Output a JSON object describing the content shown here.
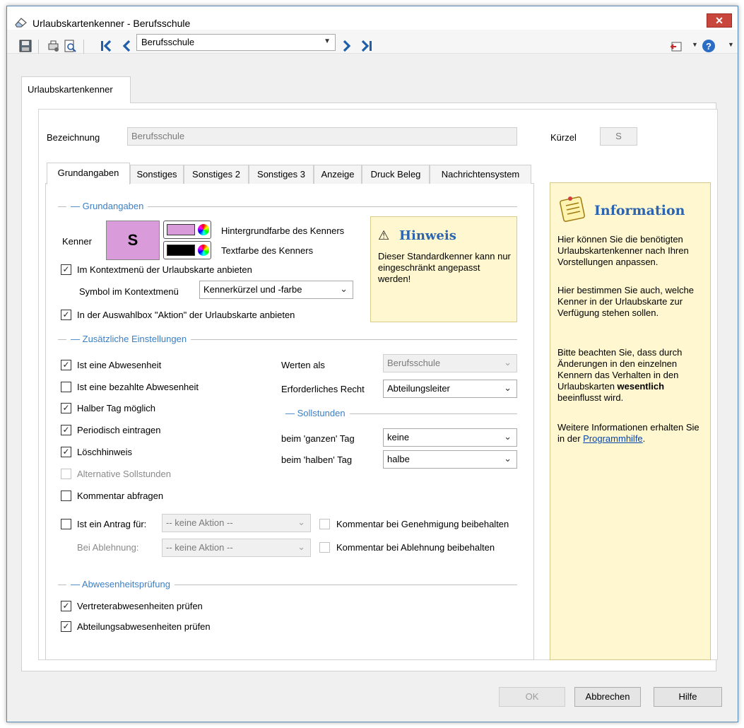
{
  "window": {
    "title": "Urlaubskartenkenner - Berufsschule",
    "close_glyph": "✕"
  },
  "toolbar": {
    "record_value": "Berufsschule",
    "icons": [
      "save-icon",
      "print-setup-icon",
      "print-preview-icon",
      "first-record-icon",
      "previous-record-icon",
      "next-record-icon",
      "last-record-icon",
      "exit-icon",
      "help-icon"
    ]
  },
  "outer_tab": {
    "label": "Urlaubskartenkenner"
  },
  "header": {
    "bezeichnung_label": "Bezeichnung",
    "bezeichnung_value": "Berufsschule",
    "kuerzel_label": "Kürzel",
    "kuerzel_value": "S"
  },
  "tabs": [
    "Grundangaben",
    "Sonstiges",
    "Sonstiges 2",
    "Sonstiges 3",
    "Anzeige",
    "Druck Beleg",
    "Nachrichtensystem"
  ],
  "grundangaben": {
    "section_title": "Grundangaben",
    "kenner_label": "Kenner",
    "kenner_symbol": "S",
    "kenner_bg_color": "#d99bd9",
    "kenner_text_color": "#000000",
    "bg_color_label": "Hintergrundfarbe des Kenners",
    "text_color_label": "Textfarbe des Kenners",
    "context_menu_label": "Im Kontextmenü der Urlaubskarte anbieten",
    "context_menu_checked": true,
    "symbol_label": "Symbol im Kontextmenü",
    "symbol_value": "Kennerkürzel und -farbe",
    "action_box_label": "In der Auswahlbox \"Aktion\" der Urlaubskarte anbieten",
    "action_box_checked": true
  },
  "hinweis": {
    "title": "Hinweis",
    "text": "Dieser Standardkenner kann nur eingeschränkt angepasst werden!"
  },
  "zusaetzliche": {
    "section_title": "Zusätzliche Einstellungen",
    "checkboxes": [
      {
        "label": "Ist eine Abwesenheit",
        "checked": true,
        "disabled": false
      },
      {
        "label": "Ist eine bezahlte Abwesenheit",
        "checked": false,
        "disabled": false
      },
      {
        "label": "Halber Tag möglich",
        "checked": true,
        "disabled": false
      },
      {
        "label": "Periodisch eintragen",
        "checked": true,
        "disabled": false
      },
      {
        "label": "Löschhinweis",
        "checked": true,
        "disabled": false
      },
      {
        "label": "Alternative Sollstunden",
        "checked": false,
        "disabled": true
      },
      {
        "label": "Kommentar abfragen",
        "checked": false,
        "disabled": false
      }
    ],
    "werten_als_label": "Werten als",
    "werten_als_value": "Berufsschule",
    "recht_label": "Erforderliches Recht",
    "recht_value": "Abteilungsleiter",
    "sollstunden_title": "Sollstunden",
    "ganzer_tag_label": "beim 'ganzen' Tag",
    "ganzer_tag_value": "keine",
    "halber_tag_label": "beim 'halben' Tag",
    "halber_tag_value": "halbe",
    "antrag_label": "Ist ein Antrag für:",
    "antrag_value": "-- keine Aktion --",
    "ablehnung_label": "Bei Ablehnung:",
    "ablehnung_value": "-- keine Aktion --",
    "kommentar_genehmigung_label": "Kommentar bei Genehmigung beibehalten",
    "kommentar_ablehnung_label": "Kommentar bei Ablehnung beibehalten"
  },
  "abwesenheitspruefung": {
    "section_title": "Abwesenheitsprüfung",
    "vertreter_label": "Vertreterabwesenheiten prüfen",
    "abteilung_label": "Abteilungsabwesenheiten prüfen"
  },
  "info": {
    "title": "Information",
    "p1": "Hier können Sie die benötigten Urlaubskartenkenner nach Ihren Vorstellungen anpassen.",
    "p2": "Hier bestimmen Sie auch, welche Kenner in der Urlaubskarte zur Verfügung stehen sollen.",
    "p3_pre": "Bitte beachten Sie, dass durch Änderungen in den einzelnen Kennern das Verhalten in den Urlaubskarten ",
    "p3_bold": "wesentlich",
    "p3_post": " beeinflusst wird.",
    "p4_pre": "Weitere Informationen erhalten Sie in der ",
    "p4_link": "Programmhilfe",
    "p4_post": "."
  },
  "buttons": {
    "ok": "OK",
    "cancel": "Abbrechen",
    "help": "Hilfe"
  }
}
